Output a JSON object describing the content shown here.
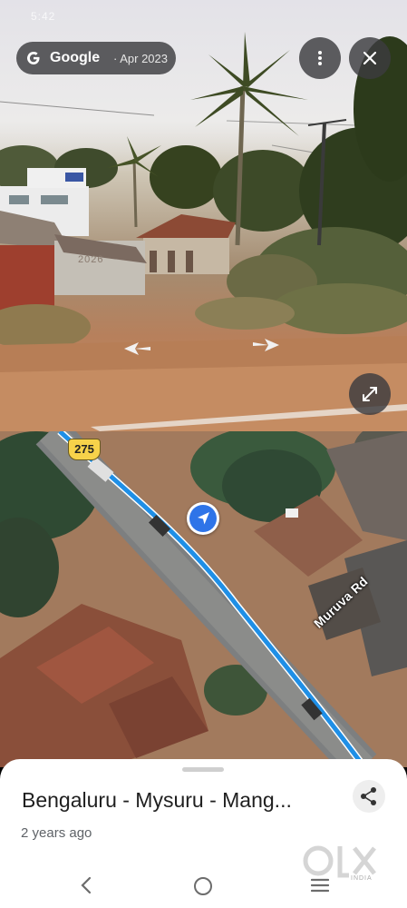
{
  "status_bar": {
    "left_text": "5:42",
    "right_text": ""
  },
  "source_pill": {
    "brand": "Google",
    "date": "· Apr 2023"
  },
  "house_sign": "2026",
  "map": {
    "route_shield": "275",
    "road_name": "Muruva Rd"
  },
  "sheet": {
    "title": "Bengaluru - Mysuru - Mang...",
    "age": "2 years ago"
  },
  "watermark": {
    "brand": "OLX",
    "sub": "INDIA"
  },
  "icons": {
    "more": "more-vert-icon",
    "close": "close-icon",
    "expand": "expand-icon",
    "share": "share-icon",
    "locator": "navigation-arrow-icon",
    "nav_back": "back-icon",
    "nav_home": "home-icon",
    "nav_recents": "recents-icon"
  },
  "colors": {
    "route": "#1f8fe6",
    "locator": "#2e74e8",
    "shield": "#f7d24a",
    "pill_bg": "#3c3c40"
  }
}
